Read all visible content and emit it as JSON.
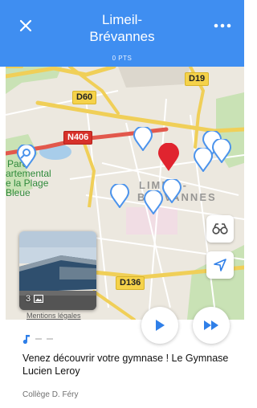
{
  "header": {
    "title_line1": "Limeil-",
    "title_line2": "Brévannes",
    "points": "0 PTS",
    "close_icon": "close-icon",
    "more_icon": "more-dots-icon",
    "background": "#3f8ef1"
  },
  "map": {
    "road_labels": [
      "D19",
      "D60",
      "N406",
      "D136"
    ],
    "road_label_partial": "",
    "place_label_lines": [
      "Parc",
      "artemental",
      "e la Plage",
      "Bleue"
    ],
    "town_label_lines": [
      "LIMEIL-",
      "BRÉVANNES"
    ],
    "pin_color": "#4b93ec",
    "selected_pin_color": "#e0242f",
    "binoculars_icon": "binoculars-icon",
    "locate_icon": "navigation-arrow-icon"
  },
  "photo": {
    "count": "3",
    "gallery_icon": "image-icon"
  },
  "legal_link": "Mentions légales",
  "player": {
    "play_icon": "play-icon",
    "next_icon": "fast-forward-icon",
    "accent": "#2f7fe8"
  },
  "content": {
    "music_icon": "music-note-icon",
    "description": "Venez découvrir votre gymnase ! Le Gymnase Lucien Leroy",
    "school": "Collège D. Féry"
  }
}
